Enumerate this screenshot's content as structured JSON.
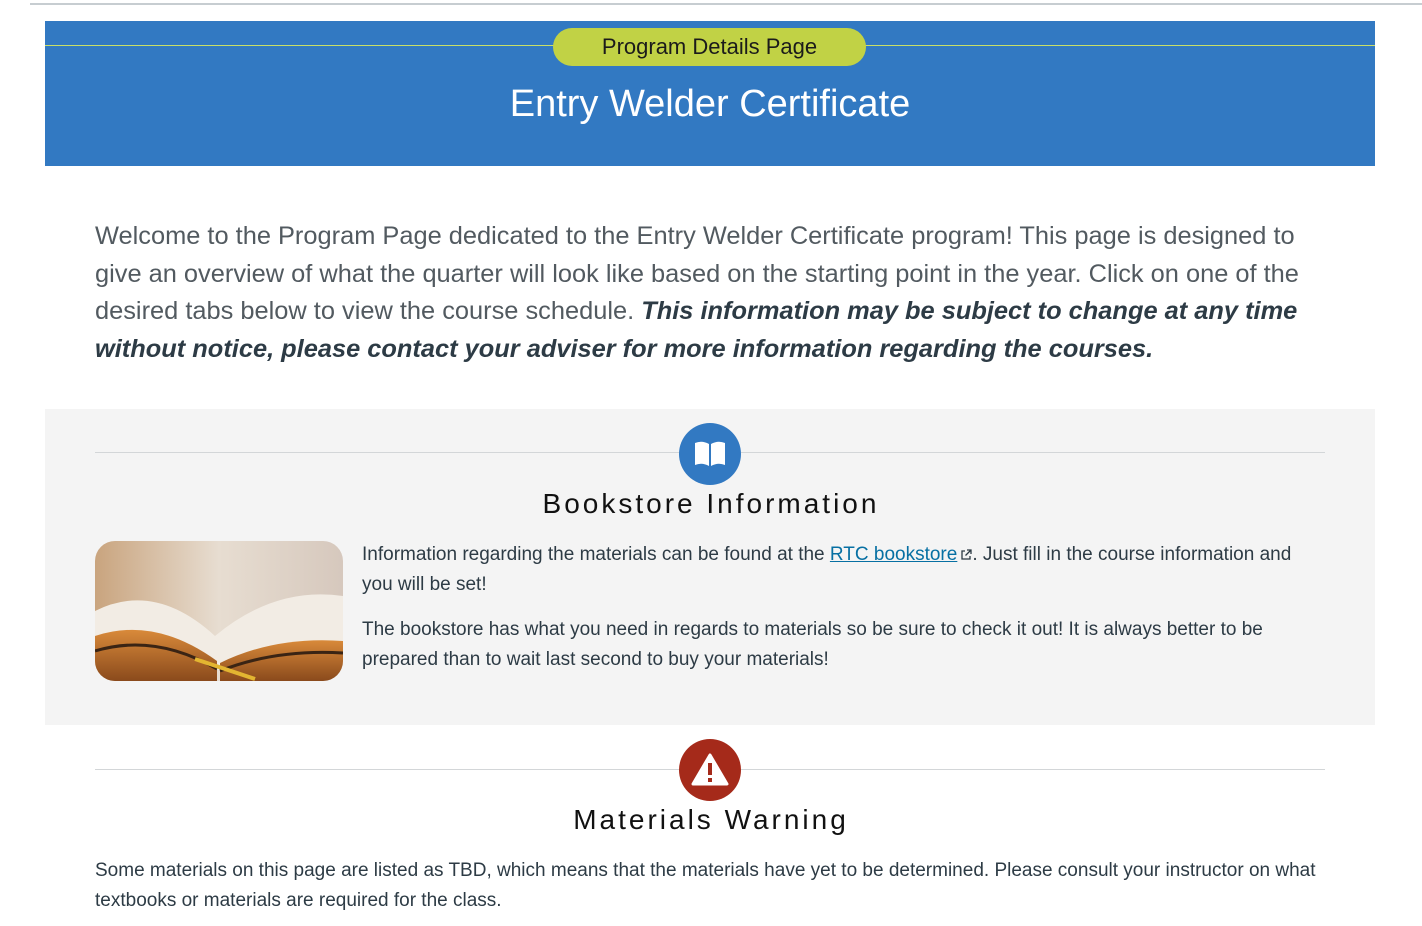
{
  "banner": {
    "label": "Program Details Page",
    "title": "Entry Welder Certificate"
  },
  "intro": {
    "text": "Welcome to the Program Page dedicated to the Entry Welder Certificate program! This page is designed to give an overview of what the quarter will look like based on the starting point in the year. Click on one of the desired tabs below to view the course schedule. ",
    "emphasis": "This information may be subject to change at any time without notice, please contact your adviser for more information regarding the courses."
  },
  "bookstore": {
    "icon": "open-book-icon",
    "icon_color": "#3279c2",
    "title": "Bookstore Information",
    "p1_before": "Information regarding the materials can be found at the ",
    "link_text": "RTC bookstore",
    "p1_after": ". Just fill in the course information and you will be set!",
    "p2": "The bookstore has what you need in regards to materials so be sure to check it out! It is always better to be prepared than to wait last second to buy your materials!"
  },
  "materials": {
    "icon": "warning-icon",
    "icon_color": "#a52a1a",
    "title": "Materials Warning",
    "text": "Some materials on this page are listed as TBD, which means that the materials have yet to be determined. Please consult your instructor on what textbooks or materials are required for the class."
  },
  "colors": {
    "banner_bg": "#3279c2",
    "banner_pill": "#c1d245",
    "section_bg": "#f4f4f4",
    "link": "#0770a3"
  }
}
